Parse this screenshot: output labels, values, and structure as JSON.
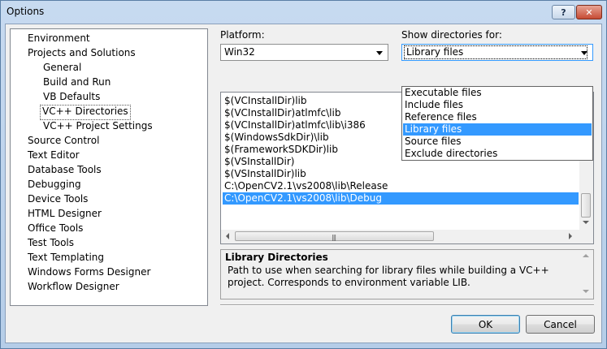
{
  "window": {
    "title": "Options",
    "help_label": "?",
    "close_label": "✕"
  },
  "tree": {
    "items": [
      {
        "label": "Environment"
      },
      {
        "label": "Projects and Solutions"
      },
      {
        "label": "General"
      },
      {
        "label": "Build and Run"
      },
      {
        "label": "VB Defaults"
      },
      {
        "label": "VC++ Directories",
        "selected": true
      },
      {
        "label": "VC++ Project Settings"
      },
      {
        "label": "Source Control"
      },
      {
        "label": "Text Editor"
      },
      {
        "label": "Database Tools"
      },
      {
        "label": "Debugging"
      },
      {
        "label": "Device Tools"
      },
      {
        "label": "HTML Designer"
      },
      {
        "label": "Office Tools"
      },
      {
        "label": "Test Tools"
      },
      {
        "label": "Text Templating"
      },
      {
        "label": "Windows Forms Designer"
      },
      {
        "label": "Workflow Designer"
      }
    ]
  },
  "platform": {
    "label": "Platform:",
    "value": "Win32"
  },
  "show_dirs": {
    "label": "Show directories for:",
    "value": "Library files",
    "options": [
      "Executable files",
      "Include files",
      "Reference files",
      "Library files",
      "Source files",
      "Exclude directories"
    ],
    "selected_index": 3
  },
  "directories": {
    "items": [
      "$(VCInstallDir)lib",
      "$(VCInstallDir)atlmfc\\lib",
      "$(VCInstallDir)atlmfc\\lib\\i386",
      "$(WindowsSdkDir)\\lib",
      "$(FrameworkSDKDir)lib",
      "$(VSInstallDir)",
      "$(VSInstallDir)lib",
      "C:\\OpenCV2.1\\vs2008\\lib\\Release",
      "C:\\OpenCV2.1\\vs2008\\lib\\Debug"
    ],
    "selected_index": 8,
    "grip_glyph": "|||"
  },
  "description": {
    "title": "Library Directories",
    "text": "Path to use when searching for library files while building a VC++ project. Corresponds to environment variable LIB."
  },
  "buttons": {
    "ok": "OK",
    "cancel": "Cancel"
  }
}
